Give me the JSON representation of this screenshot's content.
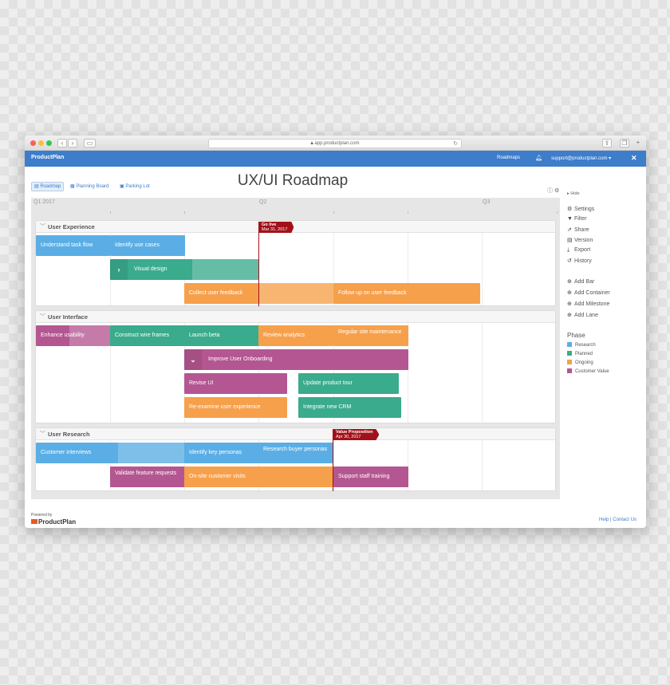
{
  "browser": {
    "url": "app.productplan.com"
  },
  "app": {
    "brand": "ProductPlan",
    "nav_roadmaps": "Roadmaps",
    "user_menu": "support@productplan.com ▾"
  },
  "tabs": [
    {
      "label": "Roadmap"
    },
    {
      "label": "Planning Board"
    },
    {
      "label": "Parking Lot"
    }
  ],
  "page_title": "UX/UI Roadmap",
  "quarters": [
    "Q1 2017",
    "Q2",
    "Q3"
  ],
  "lanes": [
    {
      "title": "User Experience"
    },
    {
      "title": "User Interface"
    },
    {
      "title": "User Research"
    }
  ],
  "bars": [
    {
      "label": "Understand task flow",
      "phase": "Research",
      "progress": 1.0
    },
    {
      "label": "Identify use cases",
      "phase": "Research",
      "progress": 0
    },
    {
      "label": "Visual design",
      "phase": "Planned",
      "progress": 0.55,
      "container": true
    },
    {
      "label": "Collect user feedback",
      "phase": "Ongoing",
      "progress": 0.5
    },
    {
      "label": "Follow up on user feedback",
      "phase": "Ongoing",
      "progress": 0
    },
    {
      "label": "Enhance usability",
      "phase": "Customer Value",
      "progress": 0.45
    },
    {
      "label": "Construct wire frames",
      "phase": "Planned",
      "progress": 0
    },
    {
      "label": "Launch beta",
      "phase": "Planned",
      "progress": 0
    },
    {
      "label": "Review analytics",
      "phase": "Ongoing",
      "progress": 0
    },
    {
      "label": "Regular site maintenance",
      "phase": "Ongoing",
      "progress": 0
    },
    {
      "label": "Improve User Onboarding",
      "phase": "Customer Value",
      "progress": 0,
      "container": true
    },
    {
      "label": "Revise UI",
      "phase": "Customer Value",
      "progress": 0
    },
    {
      "label": "Update product tour",
      "phase": "Planned",
      "progress": 0
    },
    {
      "label": "Re-examine user experience",
      "phase": "Ongoing",
      "progress": 0
    },
    {
      "label": "Integrate new CRM",
      "phase": "Planned",
      "progress": 0
    },
    {
      "label": "Customer interviews",
      "phase": "Research",
      "progress": 0.55
    },
    {
      "label": "Identify key personas",
      "phase": "Research",
      "progress": 0
    },
    {
      "label": "Research buyer personas",
      "phase": "Research",
      "progress": 0
    },
    {
      "label": "Validate feature requests",
      "phase": "Customer Value",
      "progress": 0
    },
    {
      "label": "On-site customer visits",
      "phase": "Ongoing",
      "progress": 0
    },
    {
      "label": "Support staff training",
      "phase": "Customer Value",
      "progress": 0
    }
  ],
  "milestones": [
    {
      "title": "Go live",
      "date": "Mar 31, 2017"
    },
    {
      "title": "Value Proposition",
      "date": "Apr 30, 2017"
    }
  ],
  "sidebar": {
    "hide": "Hide",
    "actions": [
      {
        "label": "Settings",
        "icon": "gear-icon"
      },
      {
        "label": "Filter",
        "icon": "filter-icon"
      },
      {
        "label": "Share",
        "icon": "share-icon"
      },
      {
        "label": "Version",
        "icon": "version-icon"
      },
      {
        "label": "Export",
        "icon": "export-icon"
      },
      {
        "label": "History",
        "icon": "history-icon"
      }
    ],
    "add_actions": [
      {
        "label": "Add Bar"
      },
      {
        "label": "Add Container"
      },
      {
        "label": "Add Milestone"
      },
      {
        "label": "Add Lane"
      }
    ],
    "phase_title": "Phase",
    "legend": [
      {
        "label": "Research",
        "color": "#5aaee5"
      },
      {
        "label": "Planned",
        "color": "#3aab8c"
      },
      {
        "label": "Ongoing",
        "color": "#f6a04b"
      },
      {
        "label": "Customer Value",
        "color": "#b45691"
      }
    ]
  },
  "footer": {
    "powered_by": "Powered by",
    "brand": "ProductPlan",
    "help": "Help",
    "separator": "|",
    "contact": "Contact Us"
  }
}
